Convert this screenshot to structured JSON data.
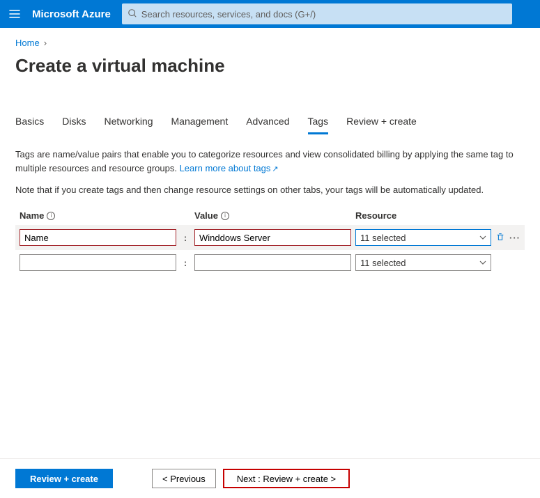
{
  "header": {
    "brand": "Microsoft Azure",
    "search_placeholder": "Search resources, services, and docs (G+/)"
  },
  "breadcrumb": {
    "home": "Home"
  },
  "page": {
    "title": "Create a virtual machine"
  },
  "tabs": [
    {
      "label": "Basics"
    },
    {
      "label": "Disks"
    },
    {
      "label": "Networking"
    },
    {
      "label": "Management"
    },
    {
      "label": "Advanced"
    },
    {
      "label": "Tags",
      "active": true
    },
    {
      "label": "Review + create"
    }
  ],
  "description": {
    "text": "Tags are name/value pairs that enable you to categorize resources and view consolidated billing by applying the same tag to multiple resources and resource groups.",
    "link": "Learn more about tags"
  },
  "note": "Note that if you create tags and then change resource settings on other tabs, your tags will be automatically updated.",
  "columns": {
    "name": "Name",
    "value": "Value",
    "resource": "Resource"
  },
  "rows": [
    {
      "name": "Name",
      "value": "Winddows Server",
      "resource": "11 selected"
    },
    {
      "name": "",
      "value": "",
      "resource": "11 selected"
    }
  ],
  "footer": {
    "review": "Review + create",
    "previous": "< Previous",
    "next": "Next : Review + create >"
  }
}
